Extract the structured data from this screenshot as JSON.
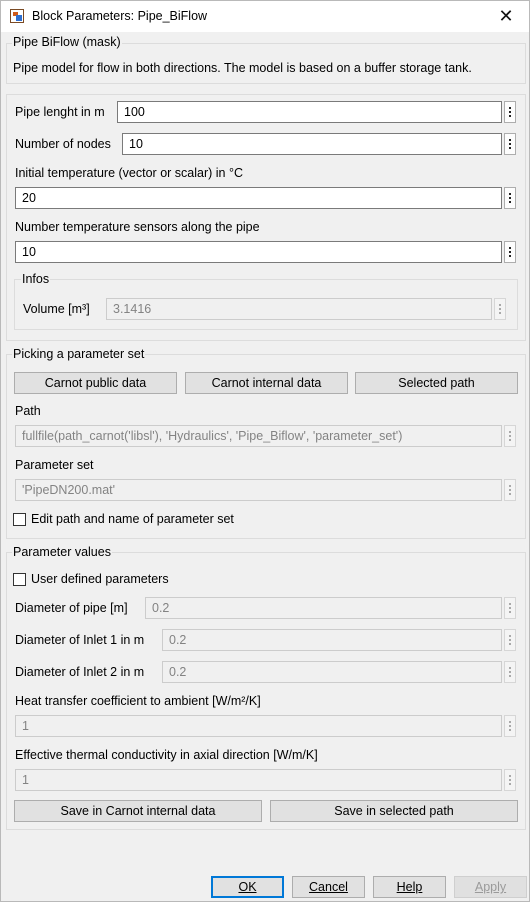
{
  "window": {
    "title": "Block Parameters: Pipe_BiFlow",
    "close_glyph": "✕"
  },
  "mask": {
    "header": "Pipe BiFlow (mask)",
    "description": "Pipe model for flow in both directions. The model is based on a buffer storage tank."
  },
  "params": {
    "pipe_length_label": "Pipe lenght in m",
    "pipe_length_value": "100",
    "nodes_label": "Number of nodes",
    "nodes_value": "10",
    "init_temp_label": "Initial temperature (vector or scalar) in °C",
    "init_temp_value": "20",
    "sensors_label": "Number temperature sensors along the pipe",
    "sensors_value": "10"
  },
  "infos": {
    "header": "Infos",
    "volume_label": "Volume [m³]",
    "volume_value": "3.1416"
  },
  "picking": {
    "header": "Picking a parameter set",
    "btn_public": "Carnot public data",
    "btn_internal": "Carnot internal data",
    "btn_selected": "Selected path",
    "path_label": "Path",
    "path_value": "fullfile(path_carnot('libsl'), 'Hydraulics', 'Pipe_Biflow', 'parameter_set')",
    "set_label": "Parameter set",
    "set_value": "'PipeDN200.mat'",
    "edit_checkbox_label": "Edit path and name of parameter set",
    "edit_checked": false
  },
  "values": {
    "header": "Parameter values",
    "user_defined_label": "User defined parameters",
    "user_defined_checked": false,
    "diameter_pipe_label": "Diameter of pipe [m]",
    "diameter_pipe_value": "0.2",
    "diameter_inlet1_label": "Diameter of Inlet 1 in m",
    "diameter_inlet1_value": "0.2",
    "diameter_inlet2_label": "Diameter of Inlet 2 in m",
    "diameter_inlet2_value": "0.2",
    "heat_transfer_label": "Heat transfer coefficient to ambient [W/m²/K]",
    "heat_transfer_value": "1",
    "conductivity_label": "Effective thermal conductivity in axial direction [W/m/K]",
    "conductivity_value": "1",
    "btn_save_internal": "Save in Carnot internal data",
    "btn_save_selected": "Save in selected path"
  },
  "footer": {
    "ok": "OK",
    "cancel": "Cancel",
    "help": "Help",
    "apply": "Apply"
  },
  "colors": {
    "focus_border": "#0078d7",
    "disabled_text": "#838383"
  }
}
